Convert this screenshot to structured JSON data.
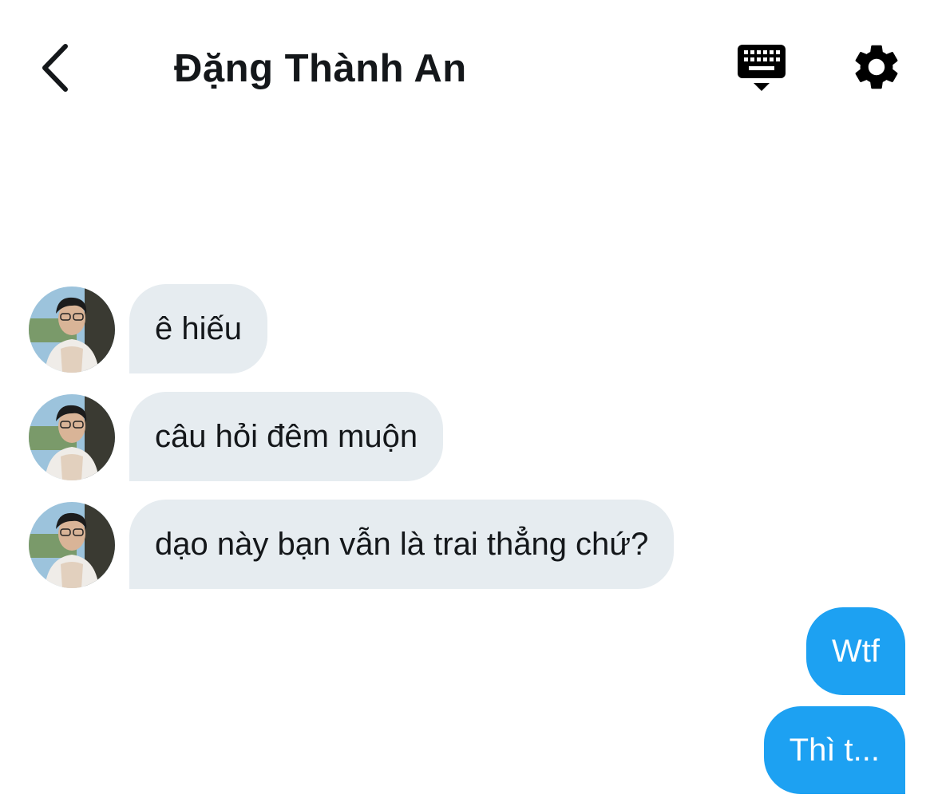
{
  "header": {
    "title": "Đặng Thành An",
    "back_icon": "chevron-left-icon",
    "keyboard_icon": "keyboard-icon",
    "settings_icon": "gear-icon"
  },
  "messages": [
    {
      "direction": "incoming",
      "text": " ê hiếu"
    },
    {
      "direction": "incoming",
      "text": "câu hỏi đêm muộn"
    },
    {
      "direction": "incoming",
      "text": "dạo này bạn vẫn là trai thẳng chứ?"
    },
    {
      "direction": "outgoing",
      "text": "Wtf"
    },
    {
      "direction": "outgoing",
      "text": "Thì t..."
    }
  ],
  "colors": {
    "incoming_bubble": "#e6ecf0",
    "outgoing_bubble": "#1da1f2",
    "text": "#14171a"
  }
}
